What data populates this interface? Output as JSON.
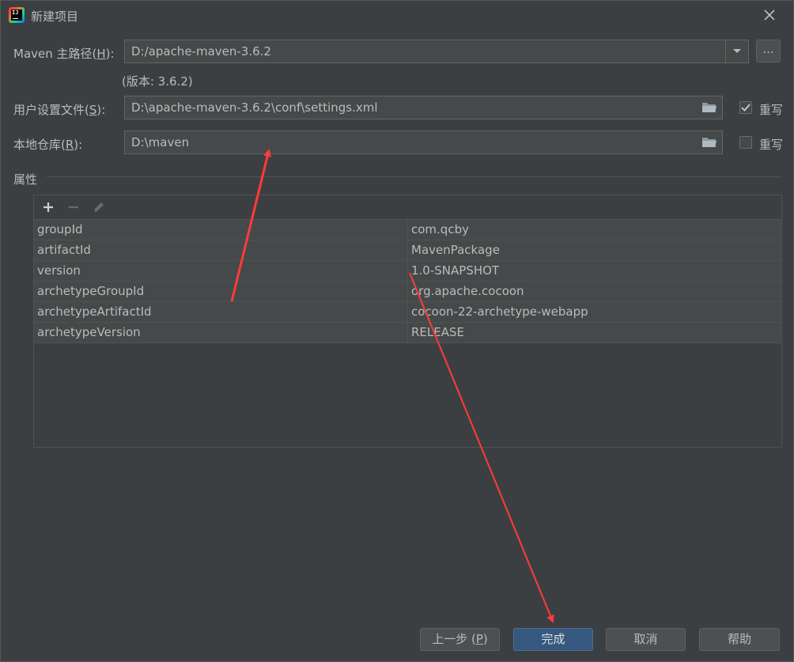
{
  "window": {
    "title": "新建项目"
  },
  "maven_home": {
    "label_prefix": "Maven 主路径(",
    "mnemonic": "H",
    "label_suffix": "):",
    "value": "D:/apache-maven-3.6.2",
    "browse_label": "..."
  },
  "version_note": "(版本: 3.6.2)",
  "settings_file": {
    "label_prefix": "用户设置文件(",
    "mnemonic": "S",
    "label_suffix": "):",
    "value": "D:\\apache-maven-3.6.2\\conf\\settings.xml",
    "override_label": "重写",
    "override_checked": true
  },
  "local_repo": {
    "label_prefix": "本地仓库(",
    "mnemonic": "R",
    "label_suffix": "):",
    "value": "D:\\maven",
    "override_label": "重写",
    "override_checked": false
  },
  "properties": {
    "title": "属性",
    "toolbar": {
      "add_icon": "plus-icon",
      "remove_icon": "minus-icon",
      "edit_icon": "pencil-icon"
    },
    "rows": [
      {
        "key": "groupId",
        "value": "com.qcby"
      },
      {
        "key": "artifactId",
        "value": "MavenPackage"
      },
      {
        "key": "version",
        "value": "1.0-SNAPSHOT"
      },
      {
        "key": "archetypeGroupId",
        "value": "org.apache.cocoon"
      },
      {
        "key": "archetypeArtifactId",
        "value": "cocoon-22-archetype-webapp"
      },
      {
        "key": "archetypeVersion",
        "value": "RELEASE"
      }
    ]
  },
  "footer": {
    "prev_label": "上一步 (",
    "prev_mnemonic": "P",
    "prev_suffix": ")",
    "finish_label": "完成",
    "cancel_label": "取消",
    "help_label": "帮助"
  },
  "colors": {
    "accent": "#365880",
    "annotation": "#ff3b3b",
    "background": "#3c3f41"
  }
}
